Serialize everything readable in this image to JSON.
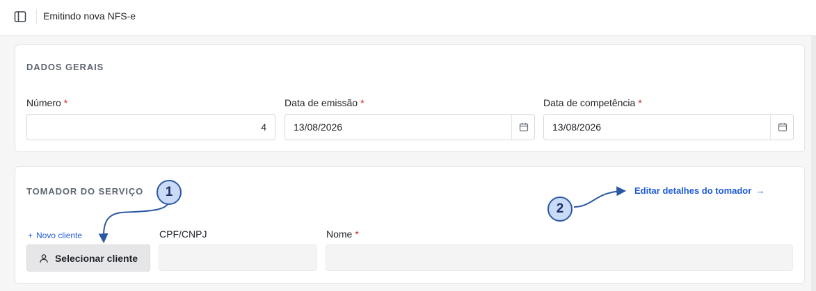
{
  "header": {
    "title": "Emitindo nova NFS-e",
    "sidebar_toggle_icon": "sidebar-toggle-icon"
  },
  "dados_gerais": {
    "section_title": "DADOS GERAIS",
    "required_mark": "*",
    "numero": {
      "label": "Número",
      "value": "4"
    },
    "data_emissao": {
      "label": "Data de emissão",
      "value": "13/08/2026",
      "icon": "calendar-icon"
    },
    "data_competencia": {
      "label": "Data de competência",
      "value": "13/08/2026",
      "icon": "calendar-icon"
    }
  },
  "tomador": {
    "section_title": "TOMADOR DO SERVIÇO",
    "edit_link": "Editar detalhes do tomador",
    "edit_link_arrow": "→",
    "novo_cliente_plus": "+",
    "novo_cliente": "Novo cliente",
    "select_button": "Selecionar cliente",
    "select_button_icon": "user-icon",
    "cpf_label": "CPF/CNPJ",
    "cpf_value": "",
    "nome_label": "Nome",
    "nome_value": ""
  },
  "annotations": {
    "badge_1": "1",
    "badge_2": "2",
    "badge_fill": "#c9dbf7",
    "badge_stroke": "#2b57a3"
  },
  "colors": {
    "accent": "#1d5bd6",
    "required": "#d01f1f",
    "page_bg": "#f6f6f7"
  }
}
